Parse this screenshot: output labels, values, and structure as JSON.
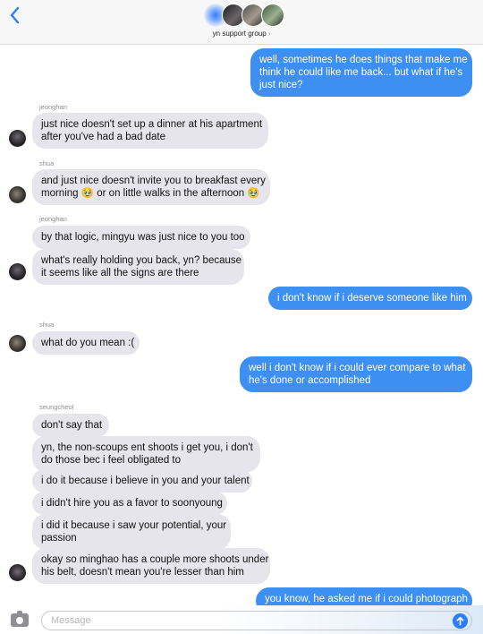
{
  "header": {
    "group_name": "yn support group",
    "chevron": "›"
  },
  "messages": [
    {
      "side": "out",
      "lines": [
        "well, sometimes he does things that make me",
        "think he could like me back... but what if he's",
        "just nice?"
      ]
    },
    {
      "sender": "jeonghan",
      "side": "in",
      "lines": [
        "just nice doesn't set up a dinner at his apartment",
        "after you've had a bad date"
      ]
    },
    {
      "sender": "shua",
      "side": "in",
      "lines": [
        "and just nice doesn't invite you to breakfast every",
        "morning 🥹 or on little walks in the afternoon 🥹"
      ]
    },
    {
      "sender": "jeonghan",
      "side": "in",
      "lines": [
        "by that logic, mingyu was just nice to you too"
      ]
    },
    {
      "side": "in",
      "lines": [
        "what's really holding you back, yn? because",
        "it seems like all the signs are there"
      ]
    },
    {
      "side": "out",
      "lines": [
        "i don't know if i deserve someone like him"
      ]
    },
    {
      "sender": "shua",
      "side": "in",
      "lines": [
        "what do you mean :("
      ]
    },
    {
      "side": "out",
      "lines": [
        "well i don't know if i could ever compare to what",
        "he's done or accomplished"
      ]
    },
    {
      "sender": "seungcheol",
      "side": "in",
      "lines": [
        "don't say that"
      ]
    },
    {
      "side": "in",
      "lines": [
        "yn, the non-scoups ent shoots i get you, i don't",
        "do those bec i feel obligated to"
      ]
    },
    {
      "side": "in",
      "lines": [
        "i do it because i believe in you and your talent"
      ]
    },
    {
      "side": "in",
      "lines": [
        "i didn't hire you as a favor to soonyoung"
      ]
    },
    {
      "side": "in",
      "lines": [
        "i did it because i saw your potential, your",
        "passion"
      ]
    },
    {
      "side": "in",
      "lines": [
        "okay so minghao has a couple more shoots under",
        "his belt, doesn't mean you're lesser than him"
      ]
    },
    {
      "side": "out",
      "lines": [
        "you know, he asked me if i could photograph"
      ]
    }
  ],
  "input": {
    "placeholder": "Message"
  },
  "icons": {
    "back": "chevron-left-icon",
    "camera": "camera-icon",
    "send": "arrow-up-icon"
  },
  "colors": {
    "outgoing_bubble": "#3d8ff2",
    "incoming_bubble": "#e6e5eb",
    "accent": "#2e7cf6"
  }
}
